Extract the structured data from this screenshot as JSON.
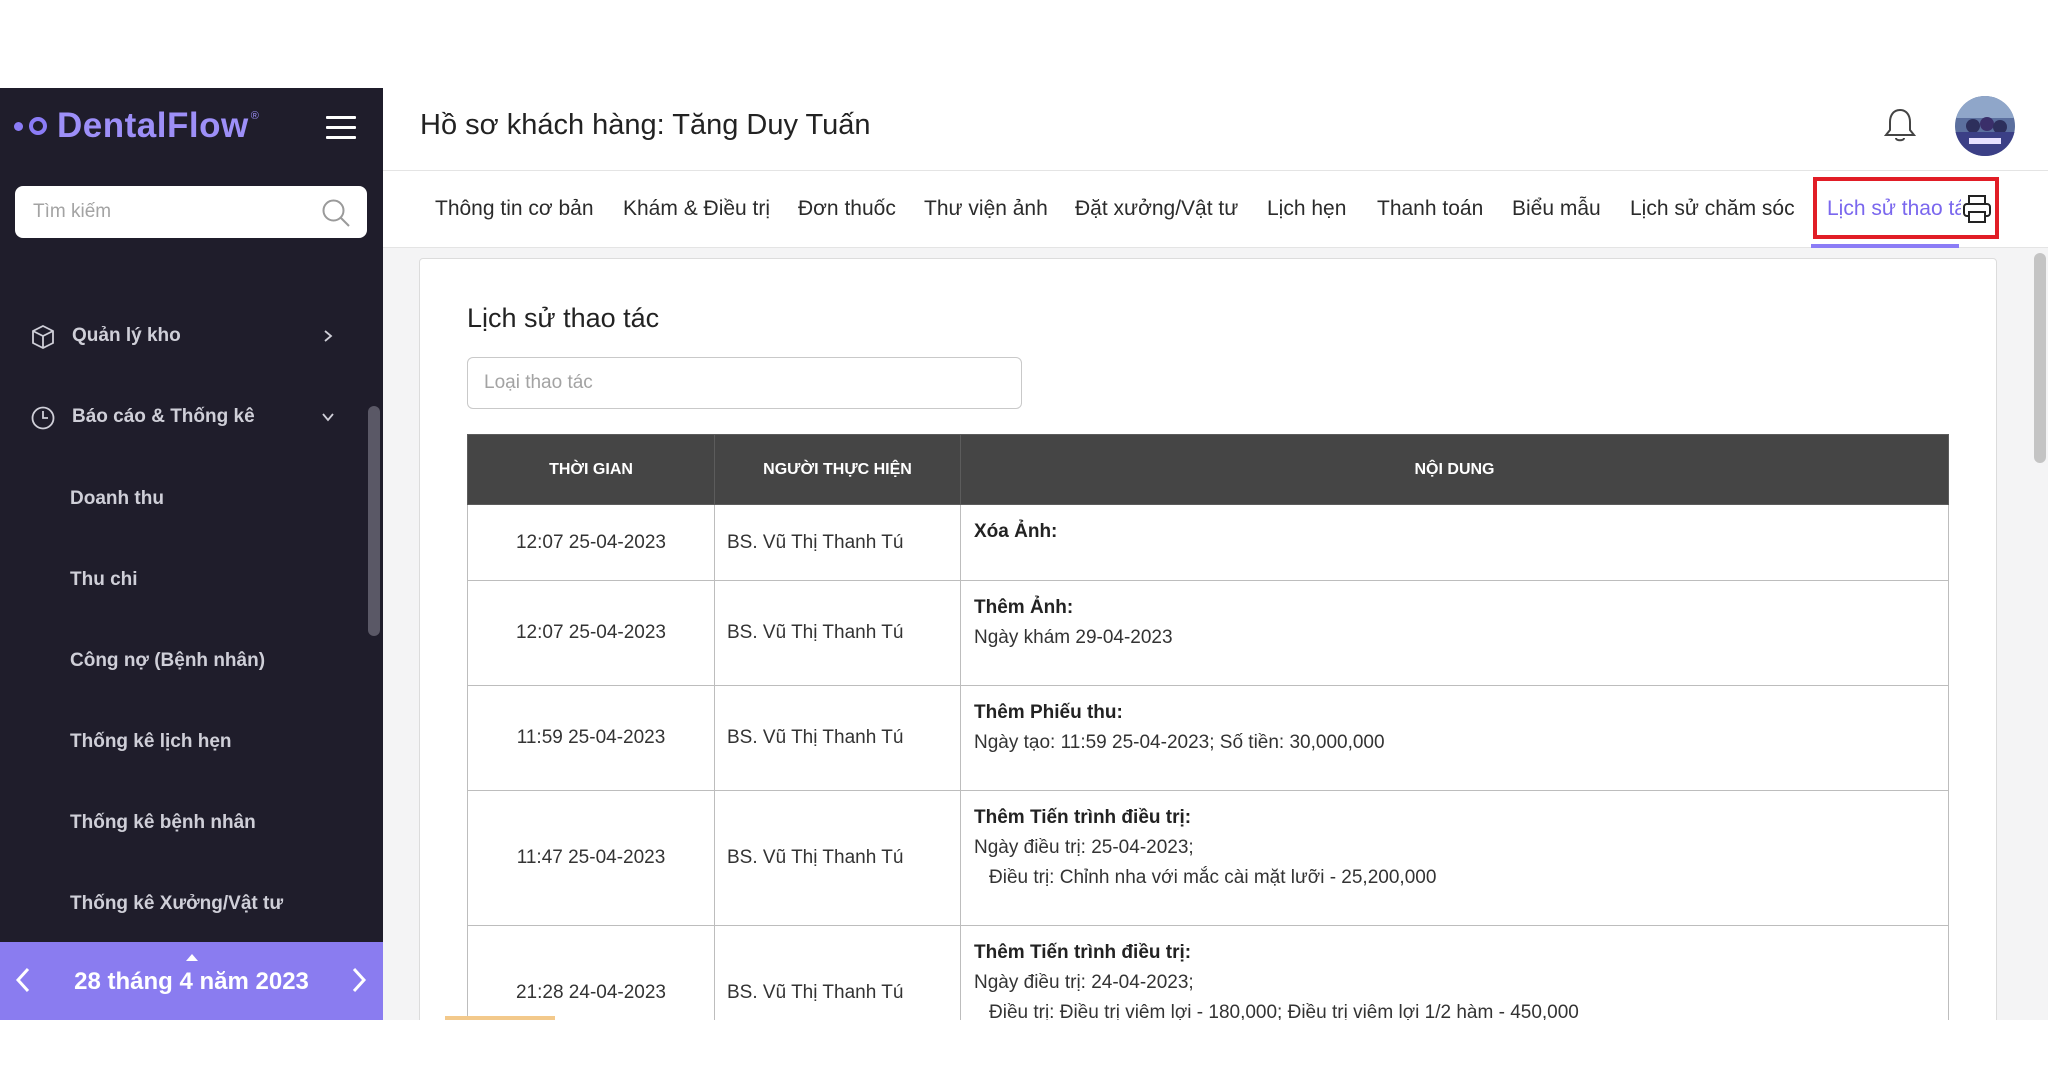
{
  "app": {
    "logo_text": "DentalFlow",
    "logo_reg": "®",
    "accent": "#8b7cf6",
    "sidebar_bg": "#1f1d2b"
  },
  "sidebar": {
    "search_placeholder": "Tìm kiếm",
    "items": [
      {
        "label": "Quản lý kho",
        "icon": "box-icon"
      },
      {
        "label": "Báo cáo & Thống kê",
        "icon": "clock-icon"
      }
    ],
    "subitems": [
      {
        "label": "Doanh thu"
      },
      {
        "label": "Thu chi"
      },
      {
        "label": "Công nợ (Bệnh nhân)"
      },
      {
        "label": "Thống kê lịch hẹn"
      },
      {
        "label": "Thống kê bệnh nhân"
      },
      {
        "label": "Thống kê Xưởng/Vật tư"
      }
    ],
    "date_label": "28 tháng 4 năm 2023"
  },
  "header": {
    "title": "Hồ sơ khách hàng: Tăng Duy Tuấn"
  },
  "tabs": [
    {
      "label": "Thông tin cơ bản"
    },
    {
      "label": "Khám & Điều trị"
    },
    {
      "label": "Đơn thuốc"
    },
    {
      "label": "Thư viện ảnh"
    },
    {
      "label": "Đặt xưởng/Vật tư"
    },
    {
      "label": "Lịch hẹn"
    },
    {
      "label": "Thanh toán"
    },
    {
      "label": "Biểu mẫu"
    },
    {
      "label": "Lịch sử chăm sóc"
    },
    {
      "label": "Lịch sử thao tác",
      "active": true
    }
  ],
  "main": {
    "title": "Lịch sử thao tác",
    "filter_placeholder": "Loại thao tác",
    "columns": [
      "THỜI GIAN",
      "NGƯỜI THỰC HIỆN",
      "NỘI DUNG"
    ],
    "rows": [
      {
        "time": "12:07 25-04-2023",
        "user": "BS. Vũ Thị Thanh Tú",
        "title": "Xóa Ảnh:",
        "lines": []
      },
      {
        "time": "12:07 25-04-2023",
        "user": "BS. Vũ Thị Thanh Tú",
        "title": "Thêm Ảnh:",
        "lines": [
          "Ngày khám 29-04-2023"
        ]
      },
      {
        "time": "11:59 25-04-2023",
        "user": "BS. Vũ Thị Thanh Tú",
        "title": "Thêm Phiếu thu:",
        "lines": [
          "Ngày tạo: 11:59 25-04-2023; Số tiền: 30,000,000"
        ]
      },
      {
        "time": "11:47 25-04-2023",
        "user": "BS. Vũ Thị Thanh Tú",
        "title": "Thêm Tiến trình điều trị:",
        "lines": [
          "Ngày điều trị: 25-04-2023;",
          "Điều trị: Chỉnh nha với mắc cài mặt lưỡi - 25,200,000"
        ]
      },
      {
        "time": "21:28 24-04-2023",
        "user": "BS. Vũ Thị Thanh Tú",
        "title": "Thêm Tiến trình điều trị:",
        "lines": [
          "Ngày điều trị: 24-04-2023;",
          "Điều trị: Điều trị viêm lợi - 180,000; Điều trị viêm lợi 1/2 hàm - 450,000"
        ]
      }
    ]
  }
}
